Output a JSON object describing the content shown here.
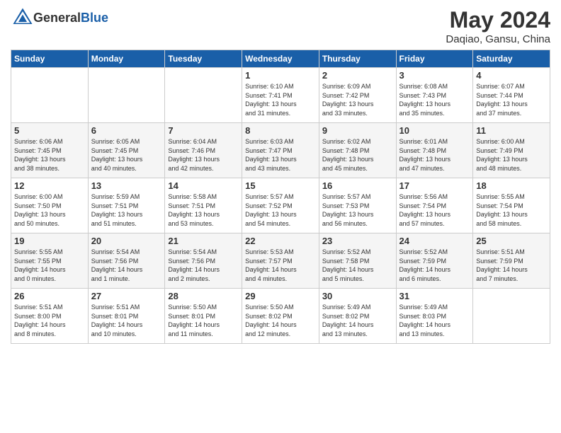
{
  "header": {
    "logo_general": "General",
    "logo_blue": "Blue",
    "title": "May 2024",
    "location": "Daqiao, Gansu, China"
  },
  "days_of_week": [
    "Sunday",
    "Monday",
    "Tuesday",
    "Wednesday",
    "Thursday",
    "Friday",
    "Saturday"
  ],
  "weeks": [
    [
      {
        "num": "",
        "info": ""
      },
      {
        "num": "",
        "info": ""
      },
      {
        "num": "",
        "info": ""
      },
      {
        "num": "1",
        "info": "Sunrise: 6:10 AM\nSunset: 7:41 PM\nDaylight: 13 hours\nand 31 minutes."
      },
      {
        "num": "2",
        "info": "Sunrise: 6:09 AM\nSunset: 7:42 PM\nDaylight: 13 hours\nand 33 minutes."
      },
      {
        "num": "3",
        "info": "Sunrise: 6:08 AM\nSunset: 7:43 PM\nDaylight: 13 hours\nand 35 minutes."
      },
      {
        "num": "4",
        "info": "Sunrise: 6:07 AM\nSunset: 7:44 PM\nDaylight: 13 hours\nand 37 minutes."
      }
    ],
    [
      {
        "num": "5",
        "info": "Sunrise: 6:06 AM\nSunset: 7:45 PM\nDaylight: 13 hours\nand 38 minutes."
      },
      {
        "num": "6",
        "info": "Sunrise: 6:05 AM\nSunset: 7:45 PM\nDaylight: 13 hours\nand 40 minutes."
      },
      {
        "num": "7",
        "info": "Sunrise: 6:04 AM\nSunset: 7:46 PM\nDaylight: 13 hours\nand 42 minutes."
      },
      {
        "num": "8",
        "info": "Sunrise: 6:03 AM\nSunset: 7:47 PM\nDaylight: 13 hours\nand 43 minutes."
      },
      {
        "num": "9",
        "info": "Sunrise: 6:02 AM\nSunset: 7:48 PM\nDaylight: 13 hours\nand 45 minutes."
      },
      {
        "num": "10",
        "info": "Sunrise: 6:01 AM\nSunset: 7:48 PM\nDaylight: 13 hours\nand 47 minutes."
      },
      {
        "num": "11",
        "info": "Sunrise: 6:00 AM\nSunset: 7:49 PM\nDaylight: 13 hours\nand 48 minutes."
      }
    ],
    [
      {
        "num": "12",
        "info": "Sunrise: 6:00 AM\nSunset: 7:50 PM\nDaylight: 13 hours\nand 50 minutes."
      },
      {
        "num": "13",
        "info": "Sunrise: 5:59 AM\nSunset: 7:51 PM\nDaylight: 13 hours\nand 51 minutes."
      },
      {
        "num": "14",
        "info": "Sunrise: 5:58 AM\nSunset: 7:51 PM\nDaylight: 13 hours\nand 53 minutes."
      },
      {
        "num": "15",
        "info": "Sunrise: 5:57 AM\nSunset: 7:52 PM\nDaylight: 13 hours\nand 54 minutes."
      },
      {
        "num": "16",
        "info": "Sunrise: 5:57 AM\nSunset: 7:53 PM\nDaylight: 13 hours\nand 56 minutes."
      },
      {
        "num": "17",
        "info": "Sunrise: 5:56 AM\nSunset: 7:54 PM\nDaylight: 13 hours\nand 57 minutes."
      },
      {
        "num": "18",
        "info": "Sunrise: 5:55 AM\nSunset: 7:54 PM\nDaylight: 13 hours\nand 58 minutes."
      }
    ],
    [
      {
        "num": "19",
        "info": "Sunrise: 5:55 AM\nSunset: 7:55 PM\nDaylight: 14 hours\nand 0 minutes."
      },
      {
        "num": "20",
        "info": "Sunrise: 5:54 AM\nSunset: 7:56 PM\nDaylight: 14 hours\nand 1 minute."
      },
      {
        "num": "21",
        "info": "Sunrise: 5:54 AM\nSunset: 7:56 PM\nDaylight: 14 hours\nand 2 minutes."
      },
      {
        "num": "22",
        "info": "Sunrise: 5:53 AM\nSunset: 7:57 PM\nDaylight: 14 hours\nand 4 minutes."
      },
      {
        "num": "23",
        "info": "Sunrise: 5:52 AM\nSunset: 7:58 PM\nDaylight: 14 hours\nand 5 minutes."
      },
      {
        "num": "24",
        "info": "Sunrise: 5:52 AM\nSunset: 7:59 PM\nDaylight: 14 hours\nand 6 minutes."
      },
      {
        "num": "25",
        "info": "Sunrise: 5:51 AM\nSunset: 7:59 PM\nDaylight: 14 hours\nand 7 minutes."
      }
    ],
    [
      {
        "num": "26",
        "info": "Sunrise: 5:51 AM\nSunset: 8:00 PM\nDaylight: 14 hours\nand 8 minutes."
      },
      {
        "num": "27",
        "info": "Sunrise: 5:51 AM\nSunset: 8:01 PM\nDaylight: 14 hours\nand 10 minutes."
      },
      {
        "num": "28",
        "info": "Sunrise: 5:50 AM\nSunset: 8:01 PM\nDaylight: 14 hours\nand 11 minutes."
      },
      {
        "num": "29",
        "info": "Sunrise: 5:50 AM\nSunset: 8:02 PM\nDaylight: 14 hours\nand 12 minutes."
      },
      {
        "num": "30",
        "info": "Sunrise: 5:49 AM\nSunset: 8:02 PM\nDaylight: 14 hours\nand 13 minutes."
      },
      {
        "num": "31",
        "info": "Sunrise: 5:49 AM\nSunset: 8:03 PM\nDaylight: 14 hours\nand 13 minutes."
      },
      {
        "num": "",
        "info": ""
      }
    ]
  ]
}
